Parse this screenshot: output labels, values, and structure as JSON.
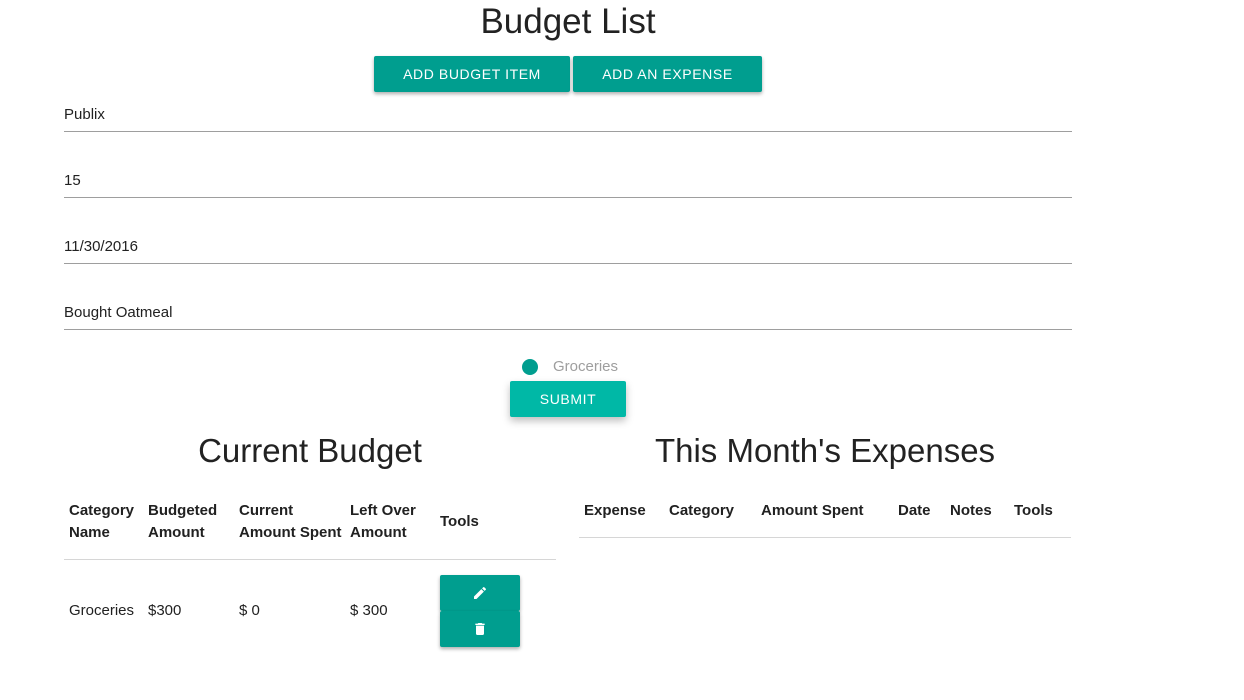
{
  "page": {
    "title": "Budget List"
  },
  "actions": {
    "add_budget_item": "ADD BUDGET ITEM",
    "add_expense": "ADD AN EXPENSE"
  },
  "expense_form": {
    "expense_name": "Publix",
    "amount": "15",
    "date": "11/30/2016",
    "notes": "Bought Oatmeal",
    "category_option": "Groceries",
    "submit_label": "SUBMIT"
  },
  "budget_table": {
    "title": "Current Budget",
    "headers": [
      "Category Name",
      "Budgeted Amount",
      "Current Amount Spent",
      "Left Over Amount",
      "Tools"
    ],
    "rows": [
      {
        "category": "Groceries",
        "budgeted": "$300",
        "spent": "$ 0",
        "left_over": "$ 300"
      }
    ]
  },
  "expenses_table": {
    "title": "This Month's Expenses",
    "headers": [
      "Expense",
      "Category",
      "Amount Spent",
      "Date",
      "Notes",
      "Tools"
    ]
  },
  "icons": {
    "edit": "pencil-icon",
    "delete": "trash-icon"
  },
  "colors": {
    "accent": "#009e8f",
    "submit": "#00b8a6"
  }
}
